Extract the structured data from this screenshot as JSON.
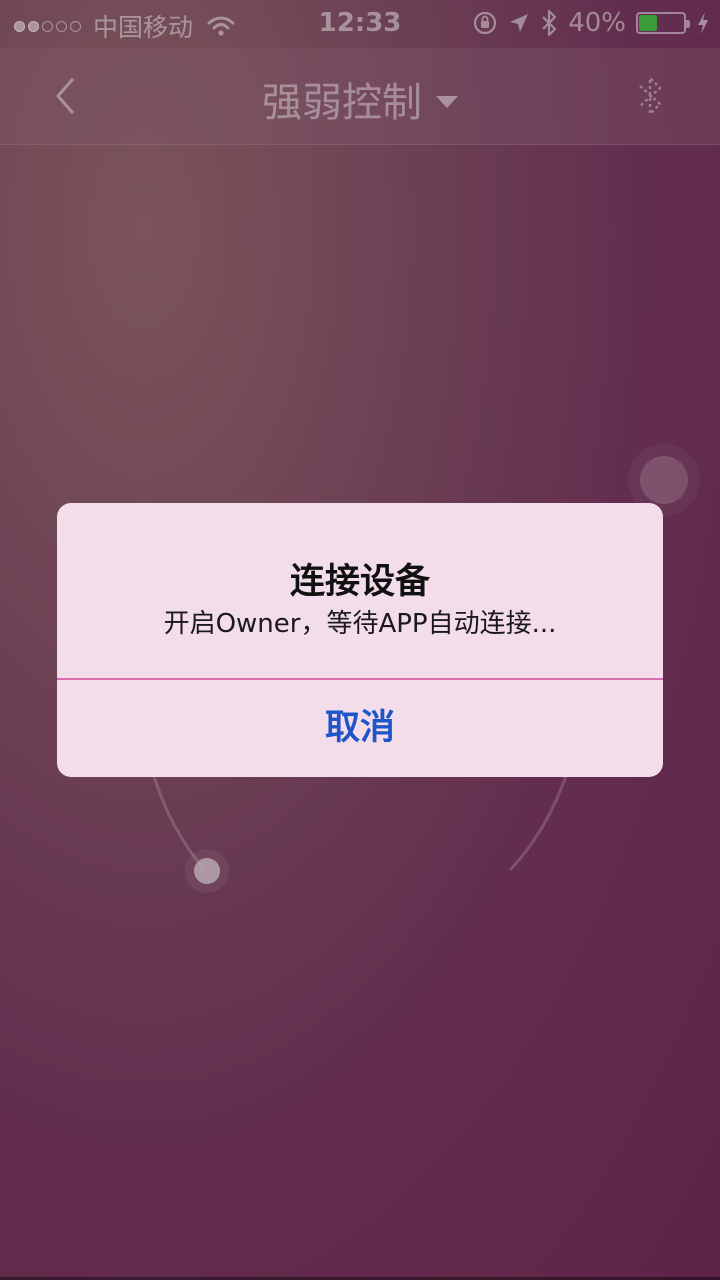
{
  "status_bar": {
    "carrier": "中国移动",
    "time": "12:33",
    "battery_percent": "40%",
    "battery_level": 0.4,
    "icons": [
      "signal-dots-icon",
      "wifi-icon",
      "rotation-lock-icon",
      "location-arrow-icon",
      "bluetooth-icon",
      "battery-icon",
      "charging-bolt-icon"
    ]
  },
  "nav": {
    "title": "强弱控制",
    "back_icon": "chevron-left-icon",
    "right_icon": "bluetooth-icon"
  },
  "alert": {
    "title": "连接设备",
    "message": "开启Owner，等待APP自动连接...",
    "cancel_label": "取消"
  },
  "colors": {
    "background_top": "#8e6868",
    "background_bottom": "#6a2c50",
    "alert_bg": "#fae4f0",
    "alert_divider": "#d86fb0",
    "button_text": "#1e55c8",
    "battery_fill": "#3fbf3f"
  }
}
